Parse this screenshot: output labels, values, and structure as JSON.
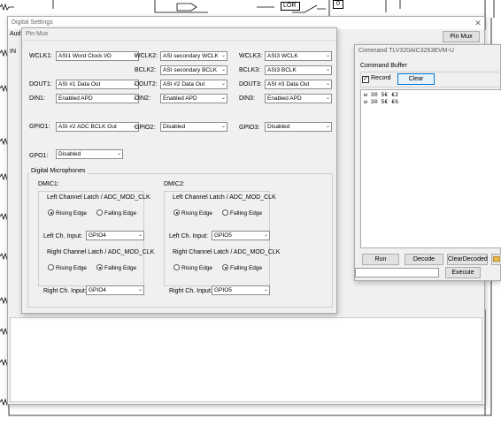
{
  "schematic": {
    "lor_label": "LOR",
    "box_value": "0"
  },
  "digital_settings": {
    "title": "Digital Settings",
    "side_label": "Aud",
    "side_label2": "IN"
  },
  "pin_mux_button": "Pin Mux",
  "pin_mux": {
    "title": "Pin Mux",
    "rows": {
      "wclk1": {
        "label": "WCLK1:",
        "value": "ASI1 Word Clock I/O"
      },
      "wclk2": {
        "label": "WCLK2:",
        "value": "ASI secondary WCLK"
      },
      "wclk3": {
        "label": "WCLK3:",
        "value": "ASI3 WCLK"
      },
      "bclk2": {
        "label": "BCLK2:",
        "value": "ASI secondary BCLK"
      },
      "bclk3": {
        "label": "BCLK3:",
        "value": "ASI3 BCLK"
      },
      "dout1": {
        "label": "DOUT1:",
        "value": "ASI #1 Data Out"
      },
      "dout2": {
        "label": "DOUT2:",
        "value": "ASI #2 Data Out"
      },
      "dout3": {
        "label": "DOUT3:",
        "value": "ASI #3 Data Out"
      },
      "din1": {
        "label": "DIN1:",
        "value": "Enabled APD"
      },
      "din2": {
        "label": "DIN2:",
        "value": "Enabled APD"
      },
      "din3": {
        "label": "DIN3:",
        "value": "Enabled APD"
      },
      "gpio1": {
        "label": "GPIO1:",
        "value": "ASI #2 ADC BCLK Out"
      },
      "gpio2": {
        "label": "GPIO2:",
        "value": "Disabled"
      },
      "gpio3": {
        "label": "GPIO3:",
        "value": "Disabled"
      },
      "gpo1": {
        "label": "GPO1:",
        "value": "Disabled"
      }
    },
    "digital_mics": {
      "title": "Digital Microphones",
      "dmic1": {
        "title": "DMIC1:",
        "left_latch_title": "Left Channel Latch / ADC_MOD_CLK",
        "left_rising": "Rising Edge",
        "left_falling": "Falling Edge",
        "left_selected": "rising",
        "left_input_label": "Left Ch. Input:",
        "left_input_value": "GPIO4",
        "right_latch_title": "Right Channel Latch / ADC_MOD_CLK",
        "right_rising": "Rising Edge",
        "right_falling": "Falling Edge",
        "right_selected": "falling",
        "right_input_label": "Right Ch. Input:",
        "right_input_value": "GPIO4"
      },
      "dmic2": {
        "title": "DMIC2:",
        "left_latch_title": "Left Channel Latch / ADC_MOD_CLK",
        "left_rising": "Rising Edge",
        "left_falling": "Falling Edge",
        "left_selected": "rising",
        "left_input_label": "Left Ch. Input:",
        "left_input_value": "GPIO5",
        "right_latch_title": "Right Channel Latch / ADC_MOD_CLK",
        "right_rising": "Rising Edge",
        "right_falling": "Falling Edge",
        "right_selected": "falling",
        "right_input_label": "Right Ch. Input:",
        "right_input_value": "GPIO5"
      }
    }
  },
  "command_window": {
    "title": "Command TLV320AIC3263EVM-U",
    "buffer_label": "Command Buffer",
    "record_label": "Record",
    "record_checked": true,
    "clear_label": "Clear",
    "lines": [
      "w 30 5€ €2",
      "w 30 5€ €6"
    ],
    "run_label": "Run",
    "decode_label": "Decode",
    "clear_decoded_label": "ClearDecoded",
    "execute_label": "Execute"
  }
}
